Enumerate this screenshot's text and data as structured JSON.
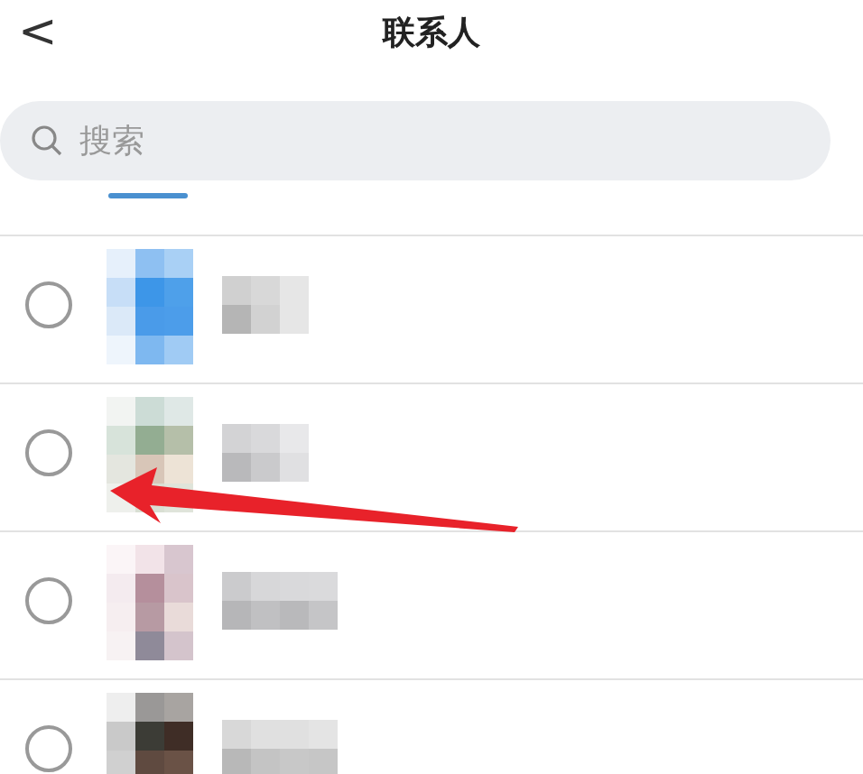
{
  "header": {
    "back_icon": "<",
    "title": "联系人"
  },
  "search": {
    "placeholder": "搜索"
  },
  "contacts": [
    {
      "selected": false
    },
    {
      "selected": false
    },
    {
      "selected": false
    },
    {
      "selected": false
    }
  ]
}
